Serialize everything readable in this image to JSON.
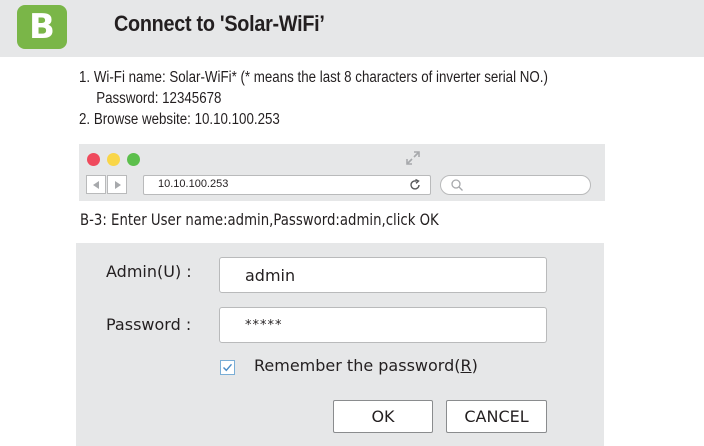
{
  "header": {
    "badge": "B",
    "title": "Connect to 'Solar-WiFi’",
    "badge_color": "#7ab648"
  },
  "instructions": {
    "line1": "1. Wi-Fi name: Solar-WiFi* (* means the last 8 characters of inverter serial NO.)",
    "line2": "Password: 12345678",
    "line3": "2. Browse website: 10.10.100.253"
  },
  "browser": {
    "window_controls": [
      "close-red",
      "minimize-yellow",
      "zoom-green"
    ],
    "icons": [
      "expand-icon",
      "back-arrow-icon",
      "forward-arrow-icon",
      "reload-icon",
      "search-icon"
    ],
    "address": "10.10.100.253",
    "search_value": ""
  },
  "step": {
    "caption": "B-3: Enter User name:admin,Password:admin,click OK"
  },
  "login": {
    "user_label": "Admin(U) :",
    "user_value": "admin",
    "password_label": "Password :",
    "password_value": "*****",
    "remember_prefix": "Remember the password",
    "remember_paren_open": "(",
    "remember_key": "R",
    "remember_paren_close": ")",
    "remember_checked": true,
    "ok_label": "OK",
    "cancel_label": "CANCEL"
  }
}
